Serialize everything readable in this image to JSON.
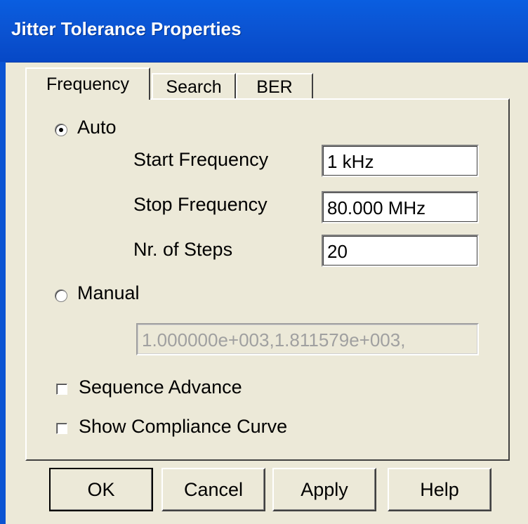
{
  "window": {
    "title": "Jitter Tolerance Properties"
  },
  "tabs": [
    {
      "label": "Frequency",
      "active": true
    },
    {
      "label": "Search",
      "active": false
    },
    {
      "label": "BER",
      "active": false
    }
  ],
  "frequency": {
    "auto_label": "Auto",
    "auto_selected": true,
    "start_label": "Start Frequency",
    "start_value": "1 kHz",
    "stop_label": "Stop Frequency",
    "stop_value": "80.000 MHz",
    "steps_label": "Nr. of Steps",
    "steps_value": "20",
    "manual_label": "Manual",
    "manual_selected": false,
    "manual_value": "1.000000e+003,1.811579e+003,",
    "sequence_advance_label": "Sequence Advance",
    "sequence_advance_checked": false,
    "compliance_label": "Show Compliance Curve",
    "compliance_checked": false
  },
  "buttons": {
    "ok": "OK",
    "cancel": "Cancel",
    "apply": "Apply",
    "help": "Help"
  },
  "colors": {
    "titlebar": "#0b54d3",
    "dialog_bg": "#ece9d8"
  }
}
